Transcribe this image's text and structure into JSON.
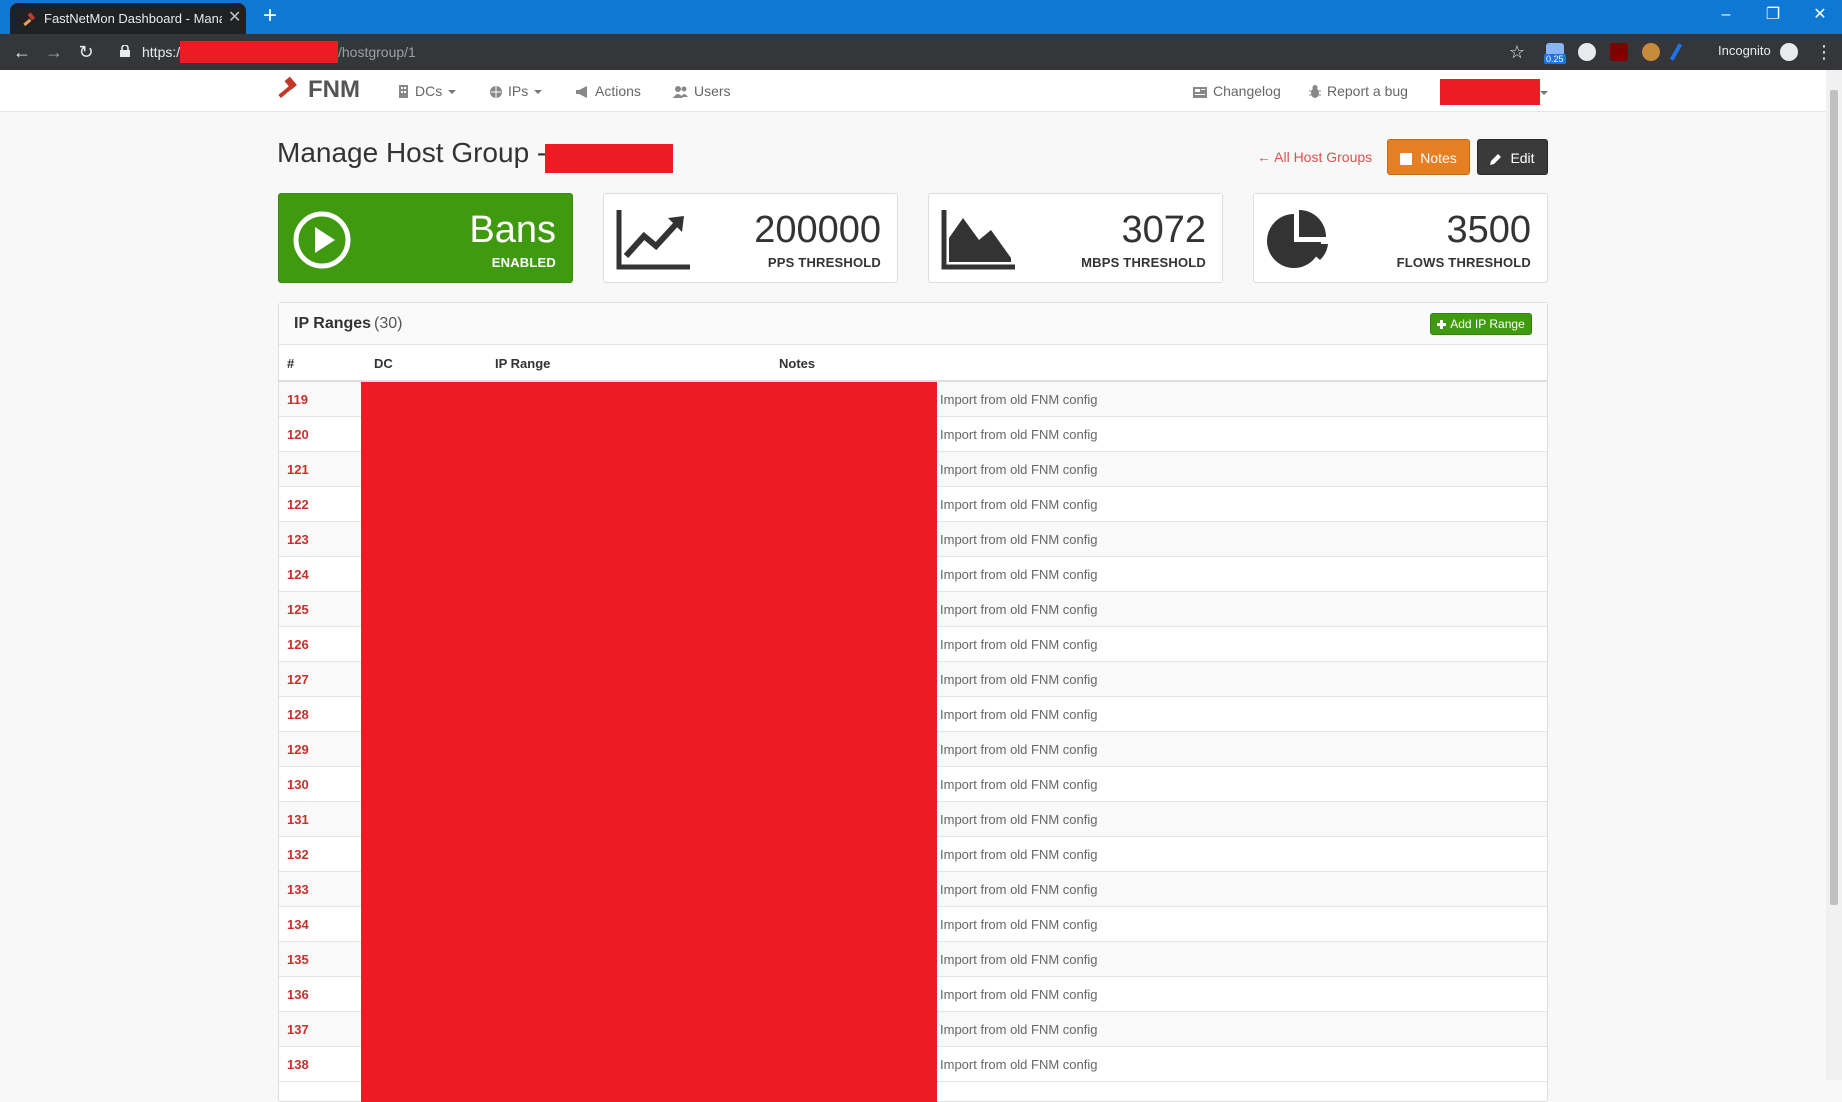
{
  "browser": {
    "tab_title": "FastNetMon Dashboard - Manage Host Group",
    "url_scheme": "https:/",
    "url_path": "/hostgroup/1",
    "profile_label": "Incognito",
    "extension_badge": "0.25"
  },
  "nav": {
    "brand": "FNM",
    "items": [
      {
        "label": "DCs"
      },
      {
        "label": "IPs"
      },
      {
        "label": "Actions"
      },
      {
        "label": "Users"
      }
    ],
    "right": [
      {
        "label": "Changelog"
      },
      {
        "label": "Report a bug"
      }
    ]
  },
  "page": {
    "title": "Manage Host Group -",
    "back_link": "← All Host Groups",
    "notes_button": "Notes",
    "edit_button": "Edit"
  },
  "stats": {
    "bans": {
      "value": "Bans",
      "label": "ENABLED"
    },
    "pps": {
      "value": "200000",
      "label": "PPS THRESHOLD"
    },
    "mbps": {
      "value": "3072",
      "label": "MBPS THRESHOLD"
    },
    "flows": {
      "value": "3500",
      "label": "FLOWS THRESHOLD"
    }
  },
  "panel": {
    "title": "IP Ranges",
    "count": "(30)",
    "add_button": "Add IP Range",
    "columns": [
      "#",
      "DC",
      "IP Range",
      "Notes"
    ],
    "rows": [
      {
        "id": "119",
        "note": "Import from old FNM config"
      },
      {
        "id": "120",
        "note": "Import from old FNM config"
      },
      {
        "id": "121",
        "note": "Import from old FNM config"
      },
      {
        "id": "122",
        "note": "Import from old FNM config"
      },
      {
        "id": "123",
        "note": "Import from old FNM config"
      },
      {
        "id": "124",
        "note": "Import from old FNM config"
      },
      {
        "id": "125",
        "note": "Import from old FNM config"
      },
      {
        "id": "126",
        "note": "Import from old FNM config"
      },
      {
        "id": "127",
        "note": "Import from old FNM config"
      },
      {
        "id": "128",
        "note": "Import from old FNM config"
      },
      {
        "id": "129",
        "note": "Import from old FNM config"
      },
      {
        "id": "130",
        "note": "Import from old FNM config"
      },
      {
        "id": "131",
        "note": "Import from old FNM config"
      },
      {
        "id": "132",
        "note": "Import from old FNM config"
      },
      {
        "id": "133",
        "note": "Import from old FNM config"
      },
      {
        "id": "134",
        "note": "Import from old FNM config"
      },
      {
        "id": "135",
        "note": "Import from old FNM config"
      },
      {
        "id": "136",
        "note": "Import from old FNM config"
      },
      {
        "id": "137",
        "note": "Import from old FNM config"
      },
      {
        "id": "138",
        "note": "Import from old FNM config"
      }
    ]
  },
  "colors": {
    "browser_titlebar": "#0f78d4",
    "success": "#3f9a10",
    "warning": "#e67e22",
    "danger_text": "#c9302c",
    "redaction": "#ed1c24"
  }
}
